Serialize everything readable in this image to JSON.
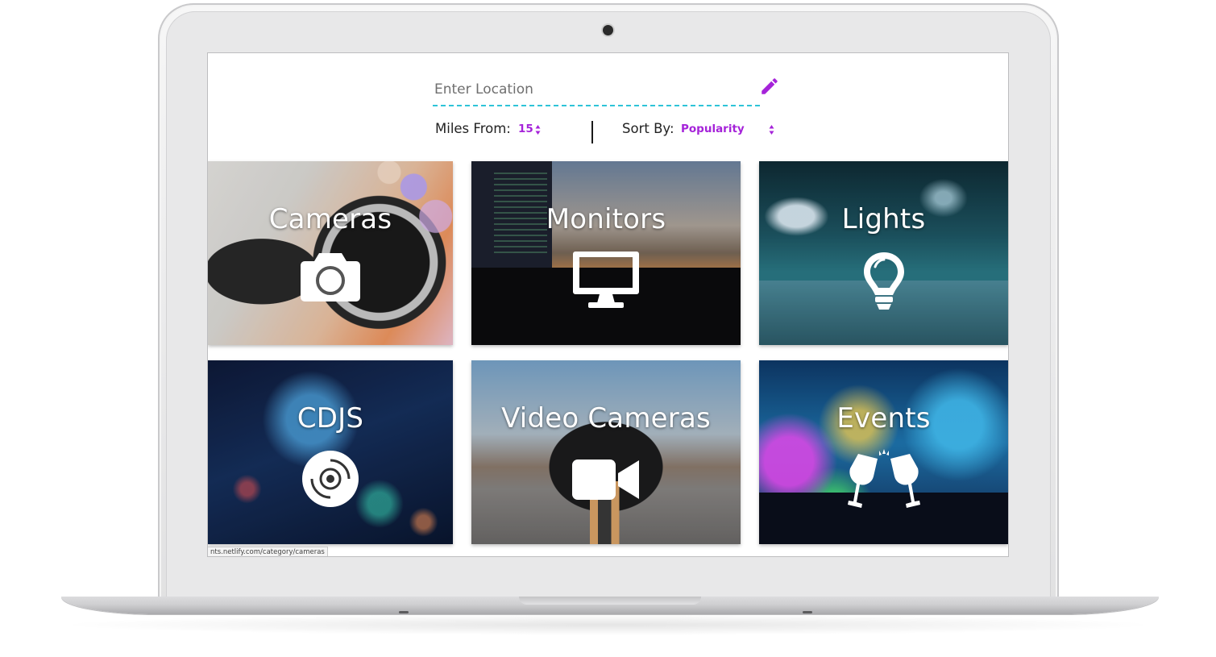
{
  "search": {
    "placeholder": "Enter Location",
    "value": ""
  },
  "filters": {
    "miles_label": "Miles From:",
    "miles_value": "15",
    "sort_label": "Sort By:",
    "sort_value": "Popularity"
  },
  "categories": [
    {
      "title": "Cameras",
      "icon": "camera-icon"
    },
    {
      "title": "Monitors",
      "icon": "monitor-icon"
    },
    {
      "title": "Lights",
      "icon": "lightbulb-icon"
    },
    {
      "title": "CDJS",
      "icon": "disc-icon"
    },
    {
      "title": "Video Cameras",
      "icon": "video-camera-icon"
    },
    {
      "title": "Events",
      "icon": "champagne-glasses-icon"
    }
  ],
  "status_bar": {
    "url": "nts.netlify.com/category/cameras"
  },
  "colors": {
    "accent": "#a523d9",
    "underline": "#2ec4d8"
  }
}
